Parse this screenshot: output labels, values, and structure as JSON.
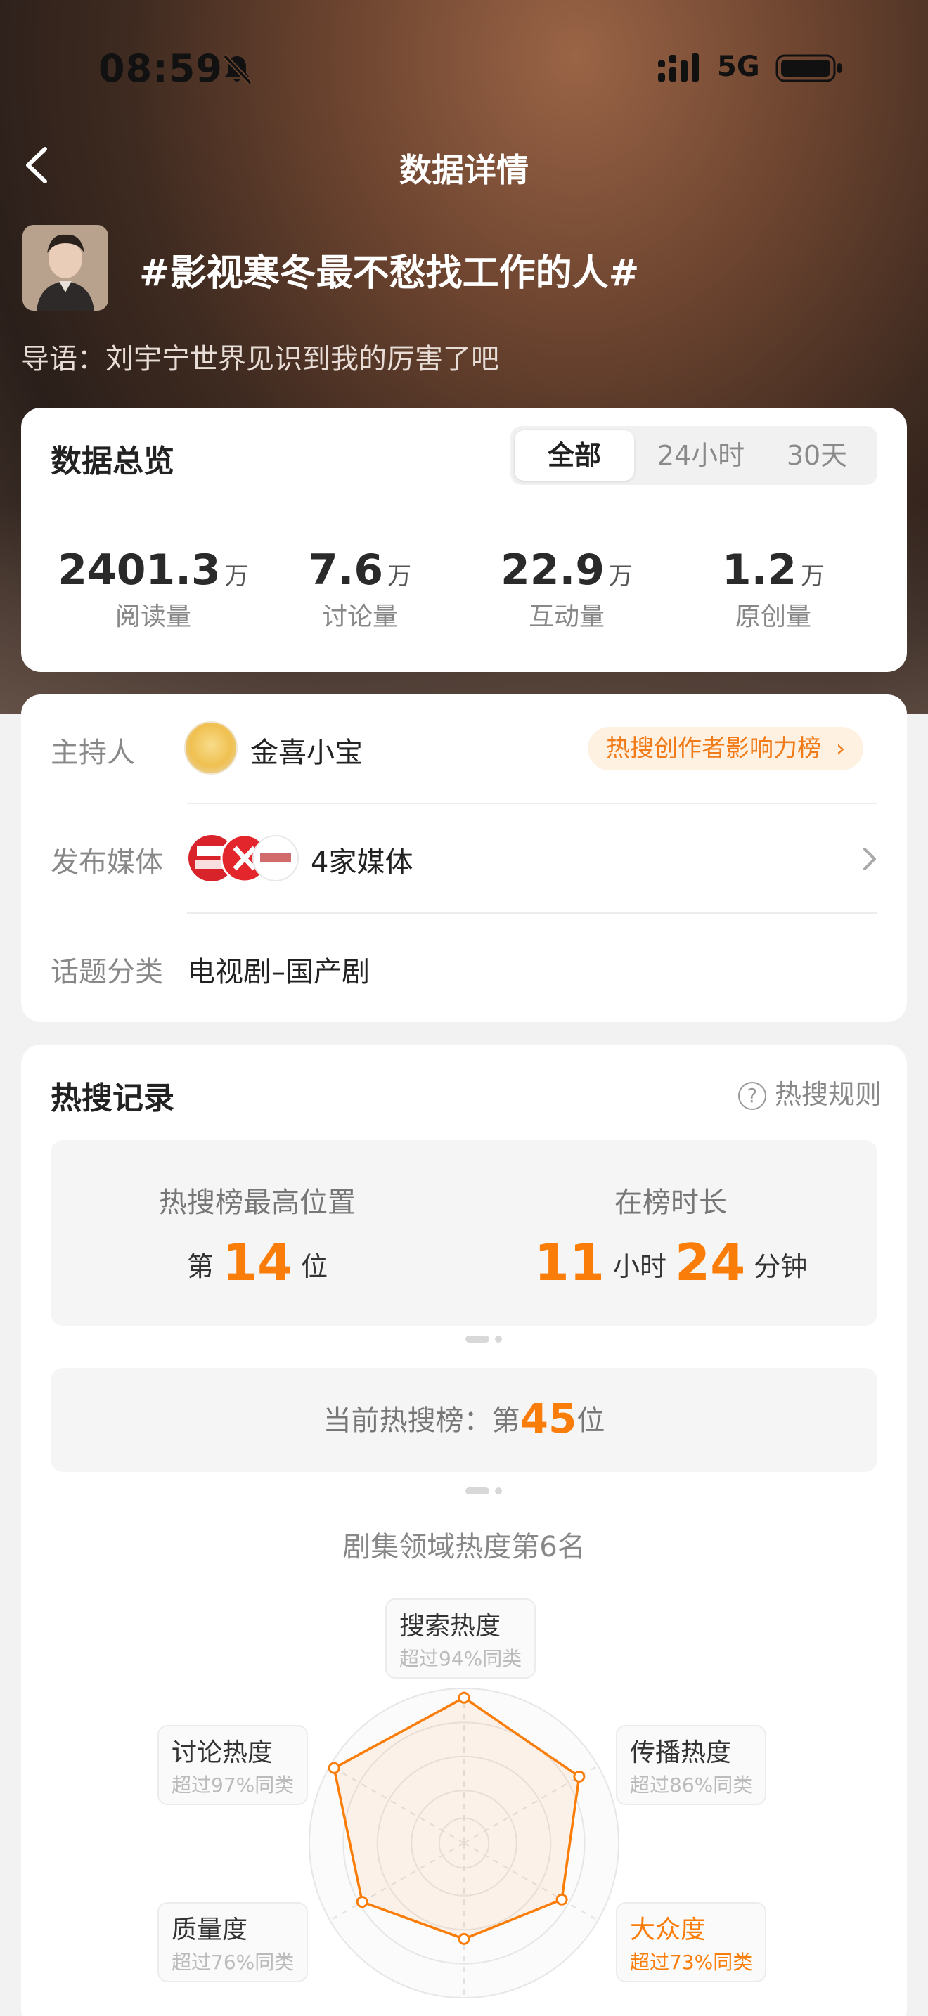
{
  "status_bar": {
    "time": "08:59",
    "network": "5G"
  },
  "nav": {
    "title": "数据详情"
  },
  "topic": {
    "name": "#影视寒冬最不愁找工作的人#",
    "lead": "导语：刘宇宁世界见识到我的厉害了吧"
  },
  "overview": {
    "title": "数据总览",
    "tabs": [
      "全部",
      "24小时",
      "30天"
    ],
    "active_tab": "全部",
    "stats": [
      {
        "value": "2401.3",
        "unit": "万",
        "label": "阅读量"
      },
      {
        "value": "7.6",
        "unit": "万",
        "label": "讨论量"
      },
      {
        "value": "22.9",
        "unit": "万",
        "label": "互动量"
      },
      {
        "value": "1.2",
        "unit": "万",
        "label": "原创量"
      }
    ]
  },
  "info": {
    "host_label": "主持人",
    "host_name": "金喜小宝",
    "host_badge": "热搜创作者影响力榜",
    "media_label": "发布媒体",
    "media_value": "4家媒体",
    "category_label": "话题分类",
    "category_value": "电视剧–国产剧"
  },
  "hot_search": {
    "title": "热搜记录",
    "rules": "热搜规则",
    "peak_label": "热搜榜最高位置",
    "peak_prefix": "第",
    "peak_value": "14",
    "peak_suffix": "位",
    "duration_label": "在榜时长",
    "hours": "11",
    "hours_unit": "小时",
    "minutes": "24",
    "minutes_unit": "分钟",
    "current_label": "当前热搜榜：第",
    "current_value": "45",
    "current_suffix": "位"
  },
  "radar": {
    "title": "剧集领域热度第6名",
    "highlight_color": "#fa7d0a",
    "axes": [
      {
        "name": "搜索热度",
        "desc": "超过94%同类",
        "value": 94
      },
      {
        "name": "传播热度",
        "desc": "超过86%同类",
        "value": 86
      },
      {
        "name": "大众度",
        "desc": "超过73%同类",
        "value": 73,
        "highlight": true
      },
      {
        "name": "",
        "desc": "",
        "value": 62
      },
      {
        "name": "质量度",
        "desc": "超过76%同类",
        "value": 76
      },
      {
        "name": "讨论热度",
        "desc": "超过97%同类",
        "value": 97
      }
    ]
  }
}
